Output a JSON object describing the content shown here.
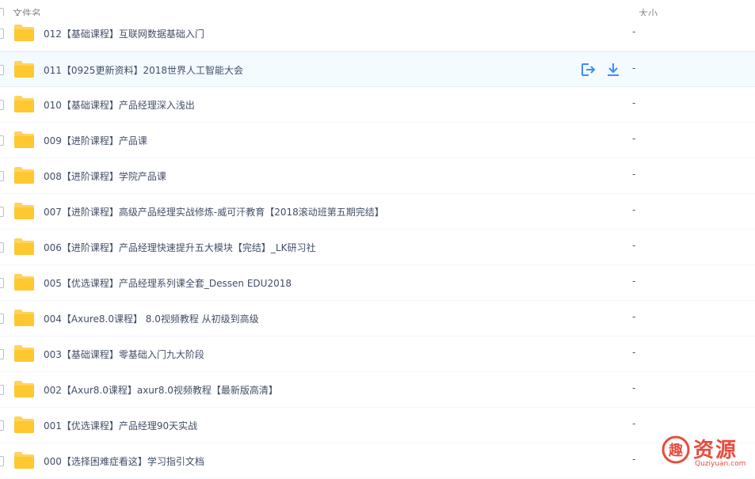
{
  "header": {
    "col_name": "文件名",
    "col_size": "大小"
  },
  "rows": [
    {
      "name": "012【基础课程】互联网数据基础入门",
      "size": "-"
    },
    {
      "name": "011【0925更新资料】2018世界人工智能大会",
      "size": "-"
    },
    {
      "name": "010【基础课程】产品经理深入浅出",
      "size": "-"
    },
    {
      "name": "009【进阶课程】产品课",
      "size": "-"
    },
    {
      "name": "008【进阶课程】学院产品课",
      "size": "-"
    },
    {
      "name": "007【进阶课程】高级产品经理实战修炼-威可汗教育【2018滚动班第五期完结】",
      "size": "-"
    },
    {
      "name": "006【进阶课程】产品经理快速提升五大模块【完结】_LK研习社",
      "size": "-"
    },
    {
      "name": "005【优选课程】产品经理系列课全套_Dessen EDU2018",
      "size": "-"
    },
    {
      "name": "004【Axure8.0课程】 8.0视频教程 从初级到高级",
      "size": "-"
    },
    {
      "name": "003【基础课程】零基础入门九大阶段",
      "size": "-"
    },
    {
      "name": "002【Axur8.0课程】axur8.0视频教程【最新版高清】",
      "size": "-"
    },
    {
      "name": "001【优选课程】产品经理90天实战",
      "size": "-"
    },
    {
      "name": "000【选择困难症看这】学习指引文档",
      "size": "-"
    }
  ],
  "row_actions": {
    "share_icon": "share-icon",
    "download_icon": "download-icon"
  },
  "colors": {
    "accent": "#3b8cff",
    "folder": "#ffd35c",
    "watermark": "#e84c3d"
  },
  "watermark": {
    "text": "资源",
    "url": "Quziyuan.com",
    "logo_glyph": "趣"
  }
}
